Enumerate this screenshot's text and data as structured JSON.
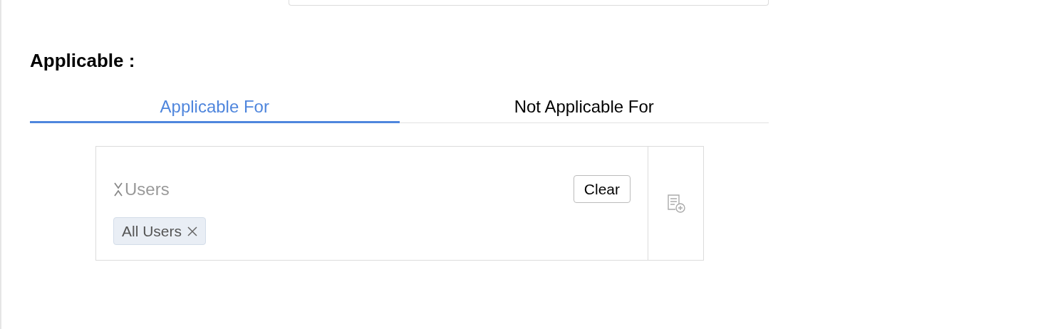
{
  "section_title": "Applicable :",
  "tabs": [
    {
      "label": "Applicable For",
      "selected": true
    },
    {
      "label": "Not Applicable For",
      "selected": false
    }
  ],
  "selector": {
    "label": "Users",
    "clear_button": "Clear",
    "chips": [
      {
        "label": "All Users"
      }
    ]
  }
}
